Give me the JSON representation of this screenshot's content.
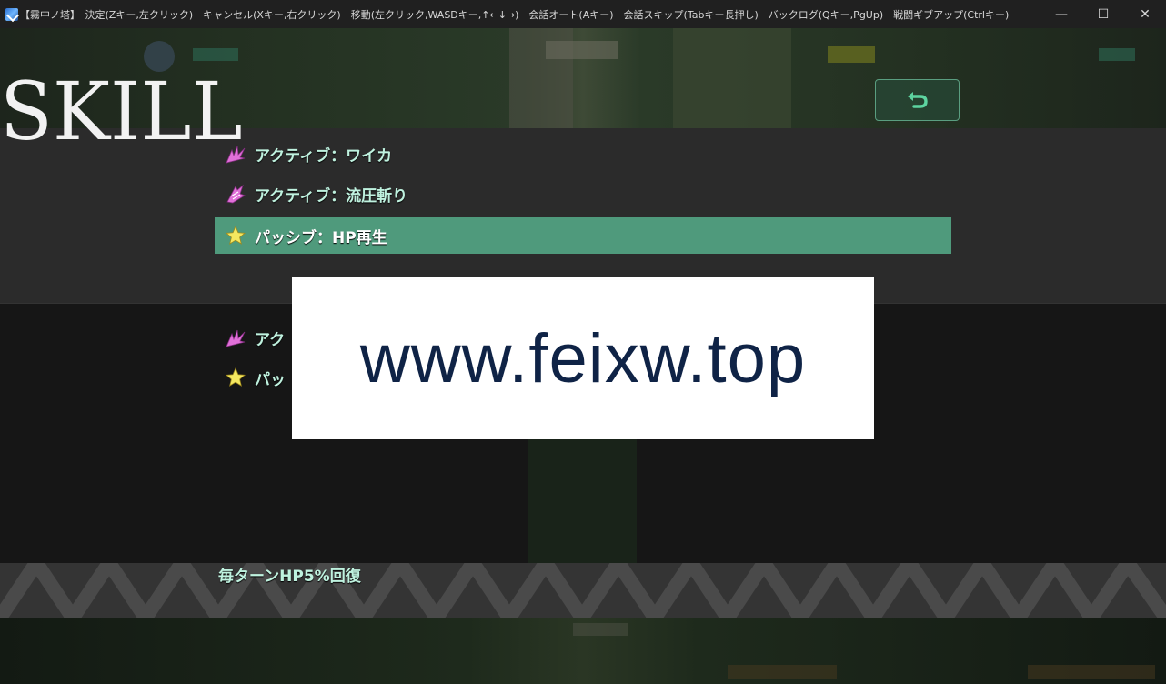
{
  "window": {
    "title": "【霧中ノ塔】　決定(Zキー,左クリック)　キャンセル(Xキー,右クリック)　移動(左クリック,WASDキー,↑←↓→)　会話オート(Aキー)　会話スキップ(Tabキー長押し)　バックログ(Qキー,PgUp)　戦闘ギブアップ(Ctrlキー)",
    "controls": {
      "minimize": "—",
      "maximize": "☐",
      "close": "✕"
    }
  },
  "screen": {
    "heading": "SKILL",
    "back_icon": "return-arrow-icon",
    "skills_upper": [
      {
        "label": "アクティブ：ワイカ",
        "icon": "burst-icon",
        "icon_color": "#e070d8",
        "selected": false
      },
      {
        "label": "アクティブ：流圧斬り",
        "icon": "slash-icon",
        "icon_color": "#e070d8",
        "selected": false
      },
      {
        "label": "パッシブ：HP再生",
        "icon": "star-icon",
        "icon_color": "#f4e860",
        "selected": true
      }
    ],
    "skills_lower": [
      {
        "label": "アク",
        "icon": "burst-icon",
        "icon_color": "#e070d8"
      },
      {
        "label": "パッ",
        "icon": "star-icon",
        "icon_color": "#f4e860"
      }
    ],
    "description": "毎ターンHP5%回復"
  },
  "overlay": {
    "watermark": "www.feixw.top"
  },
  "colors": {
    "selected_row": "#4f9a7c",
    "label_text": "#bff2df",
    "back_border": "#5a9e80"
  }
}
